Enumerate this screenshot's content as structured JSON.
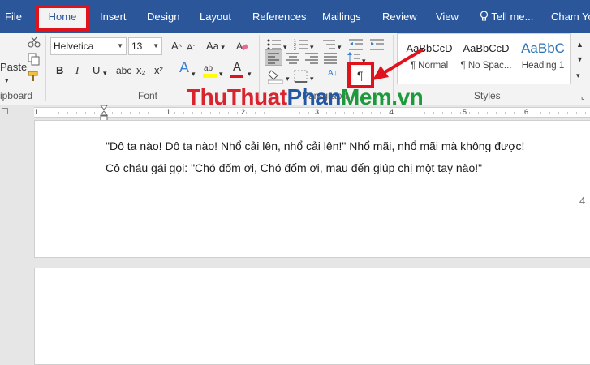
{
  "tabs": [
    "File",
    "Home",
    "Insert",
    "Design",
    "Layout",
    "References",
    "Mailings",
    "Review",
    "View"
  ],
  "tell_me": "Tell me...",
  "user_name": "Cham Yo",
  "clipboard": {
    "paste_label": "Paste",
    "group_label": "Clipboard"
  },
  "font": {
    "family": "Helvetica",
    "size": "13",
    "grow_shrink": "Aa",
    "bold": "B",
    "italic": "I",
    "underline": "U",
    "strike": "abc",
    "subscript": "x₂",
    "superscript": "x²",
    "text_effect": "A",
    "font_color": "A",
    "group_label": "Font"
  },
  "paragraph": {
    "group_label": "Paragraph",
    "show_hide_mark": "¶",
    "sort_label": "A↓"
  },
  "styles": {
    "group_label": "Styles",
    "items": [
      {
        "preview": "AaBbCcD",
        "name": "¶ Normal"
      },
      {
        "preview": "AaBbCcD",
        "name": "¶ No Spac..."
      },
      {
        "preview": "AaBbC",
        "name": "Heading 1"
      }
    ]
  },
  "watermark": {
    "part1": "Thu",
    "part2": "Thuat",
    "part3": "Phan",
    "part4": "Mem",
    "part5": ".vn"
  },
  "ruler_numbers": [
    "1",
    "1",
    "2",
    "3",
    "4",
    "5",
    "6"
  ],
  "document": {
    "line1": "\"Dô ta nào! Dô ta nào! Nhổ cải lên, nhổ cải lên!\" Nhổ mãi, nhổ mãi mà không được!",
    "line2": "Cô cháu gái gọi: \"Chó đốm ơi, Chó đốm ơi, mau đến giúp chị một tay nào!\"",
    "page_number": "4"
  },
  "colors": {
    "ribbon_blue": "#2b579a",
    "highlight_red": "#e0121b",
    "watermark_red": "#d9232d",
    "watermark_green": "#1e9a3c",
    "watermark_blue": "#2257a6"
  }
}
